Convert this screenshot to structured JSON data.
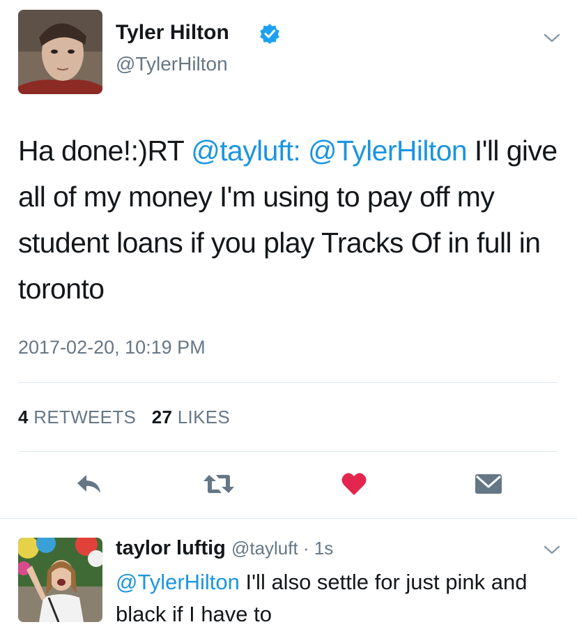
{
  "tweet": {
    "author_name": "Tyler Hilton",
    "author_handle": "@TylerHilton",
    "text_prefix": "Ha done!:)RT ",
    "mention1": "@tayluft:",
    "space1": " ",
    "mention2": "@TylerHilton",
    "text_body": " I'll give all of my money I'm using to pay off my student loans if you play Tracks Of in full in toronto",
    "timestamp": "2017-02-20, 10:19 PM",
    "retweets_count": "4",
    "retweets_label": "RETWEETS",
    "likes_count": "27",
    "likes_label": "LIKES",
    "actions": {
      "reply_icon": "reply-icon",
      "retweet_icon": "retweet-icon",
      "like_icon": "heart-icon",
      "dm_icon": "envelope-icon"
    }
  },
  "reply": {
    "author_name": "taylor luftig",
    "author_handle": "@tayluft",
    "separator": " · ",
    "time": "1s",
    "mention": "@TylerHilton",
    "text_body": " I'll also settle for just pink and black if I have to"
  },
  "colors": {
    "link": "#1b95e0",
    "muted": "#657786",
    "like": "#e2264d",
    "verified": "#1da1f2",
    "divider": "#e1e8ed"
  }
}
